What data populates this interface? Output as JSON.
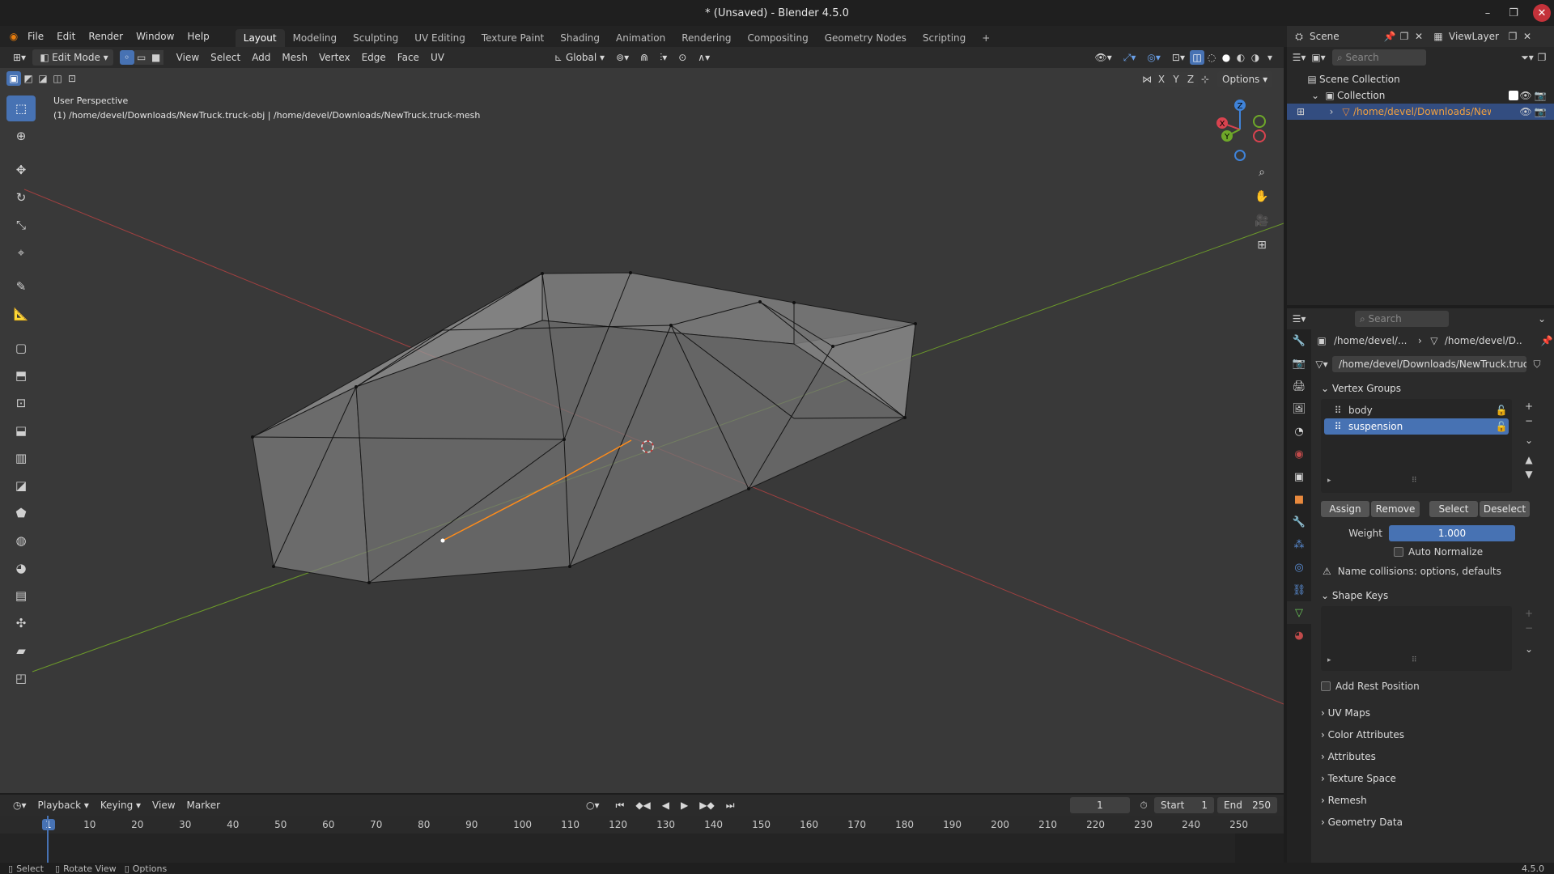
{
  "window": {
    "title": "* (Unsaved) - Blender 4.5.0",
    "min": "–",
    "max": "❐",
    "close": "✕"
  },
  "menu": [
    "File",
    "Edit",
    "Render",
    "Window",
    "Help"
  ],
  "workspaces": [
    "Layout",
    "Modeling",
    "Sculpting",
    "UV Editing",
    "Texture Paint",
    "Shading",
    "Animation",
    "Rendering",
    "Compositing",
    "Geometry Nodes",
    "Scripting"
  ],
  "active_workspace": "Layout",
  "viewport_header": {
    "mode": "Edit Mode",
    "menus": [
      "View",
      "Select",
      "Add",
      "Mesh",
      "Vertex",
      "Edge",
      "Face",
      "UV"
    ],
    "transform": "Global",
    "axes": [
      "X",
      "Y",
      "Z"
    ],
    "options": "Options"
  },
  "viewport": {
    "perspective": "User Perspective",
    "object_info": "(1) /home/devel/Downloads/NewTruck.truck-obj | /home/devel/Downloads/NewTruck.truck-mesh"
  },
  "gizmo": {
    "x": "X",
    "y": "Y",
    "z": "Z",
    "x_color": "#d8434f",
    "y_color": "#6ea829",
    "z_color": "#3f83d9"
  },
  "outliner": {
    "scene": "Scene",
    "view_layer": "ViewLayer",
    "search_placeholder": "Search",
    "scene_collection": "Scene Collection",
    "collection": "Collection",
    "object": "/home/devel/Downloads/NewTru"
  },
  "properties": {
    "search_placeholder": "Search",
    "breadcrumb1": "/home/devel/...",
    "breadcrumb2": "/home/devel/D...",
    "mesh_name": "/home/devel/Downloads/NewTruck.truc...",
    "vertex_groups_title": "Vertex Groups",
    "groups": [
      {
        "name": "body",
        "selected": false
      },
      {
        "name": "suspension",
        "selected": true
      }
    ],
    "assign": "Assign",
    "remove": "Remove",
    "select": "Select",
    "deselect": "Deselect",
    "weight_label": "Weight",
    "weight_value": "1.000",
    "auto_normalize": "Auto Normalize",
    "warning": "Name collisions: options, defaults",
    "shape_keys_title": "Shape Keys",
    "add_rest_position": "Add Rest Position",
    "sections": [
      "UV Maps",
      "Color Attributes",
      "Attributes",
      "Texture Space",
      "Remesh",
      "Geometry Data"
    ]
  },
  "timeline": {
    "menus": [
      "Playback",
      "Keying",
      "View",
      "Marker"
    ],
    "current_frame": "1",
    "start_label": "Start",
    "start": "1",
    "end_label": "End",
    "end": "250",
    "ticks": [
      "1",
      "10",
      "20",
      "30",
      "40",
      "50",
      "60",
      "70",
      "80",
      "90",
      "100",
      "110",
      "120",
      "130",
      "140",
      "150",
      "160",
      "170",
      "180",
      "190",
      "200",
      "210",
      "220",
      "230",
      "240",
      "250"
    ]
  },
  "statusbar": {
    "select": "Select",
    "rotate": "Rotate View",
    "options": "Options",
    "version": "4.5.0"
  },
  "colors": {
    "accent": "#4772b3",
    "selection": "#ff8c1a",
    "x_axis": "#b03030",
    "y_axis": "#6c9a2a"
  }
}
